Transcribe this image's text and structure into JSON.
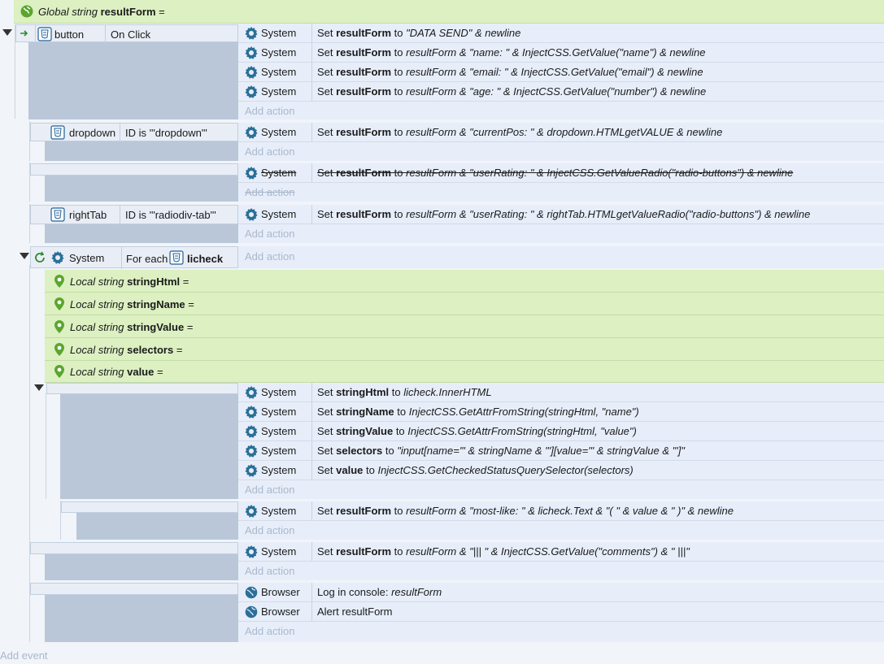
{
  "global": {
    "kind": "Global string",
    "name": "resultForm",
    "eq": "="
  },
  "obj": {
    "system": "System",
    "browser": "Browser"
  },
  "add_action": "Add action",
  "add_event": "Add event",
  "ev1": {
    "object": "button",
    "trigger": "On Click",
    "a1": {
      "pre": "Set ",
      "var": "resultForm",
      "mid": " to ",
      "expr": "\"DATA SEND\" & newline"
    },
    "a2": {
      "pre": "Set ",
      "var": "resultForm",
      "mid": " to ",
      "expr": "resultForm & \"name: \" & InjectCSS.GetValue(\"name\") & newline"
    },
    "a3": {
      "pre": "Set ",
      "var": "resultForm",
      "mid": " to ",
      "expr": "resultForm & \"email: \" & InjectCSS.GetValue(\"email\") & newline"
    },
    "a4": {
      "pre": "Set ",
      "var": "resultForm",
      "mid": " to ",
      "expr": "resultForm & \"age: \" & InjectCSS.GetValue(\"number\") & newline"
    }
  },
  "ev2": {
    "object": "dropdown",
    "cond": "ID is '\"dropdown\"'",
    "a1": {
      "pre": "Set ",
      "var": "resultForm",
      "mid": " to ",
      "expr": "resultForm & \"currentPos: \" & dropdown.HTMLgetVALUE & newline"
    }
  },
  "ev3": {
    "a1": {
      "pre": "Set ",
      "var": "resultForm",
      "mid": " to ",
      "expr": "resultForm & \"userRating: \" & InjectCSS.GetValueRadio(\"radio-buttons\") & newline"
    }
  },
  "ev4": {
    "object": "rightTab",
    "cond": "ID is '\"radiodiv-tab\"'",
    "a1": {
      "pre": "Set ",
      "var": "resultForm",
      "mid": " to ",
      "expr": "resultForm & \"userRating: \" & rightTab.HTMLgetValueRadio(\"radio-buttons\") & newline"
    }
  },
  "ev5": {
    "object": "System",
    "trigger": "For each",
    "iter": "licheck",
    "locals": [
      {
        "kind": "Local string",
        "name": "stringHtml",
        "eq": "="
      },
      {
        "kind": "Local string",
        "name": "stringName",
        "eq": "="
      },
      {
        "kind": "Local string",
        "name": "stringValue",
        "eq": "="
      },
      {
        "kind": "Local string",
        "name": "selectors",
        "eq": "="
      },
      {
        "kind": "Local string",
        "name": "value",
        "eq": "="
      }
    ],
    "s1": [
      {
        "pre": "Set ",
        "var": "stringHtml",
        "mid": " to ",
        "expr": "licheck.InnerHTML"
      },
      {
        "pre": "Set ",
        "var": "stringName",
        "mid": " to ",
        "expr": "InjectCSS.GetAttrFromString(stringHtml, \"name\")"
      },
      {
        "pre": "Set ",
        "var": "stringValue",
        "mid": " to ",
        "expr": "InjectCSS.GetAttrFromString(stringHtml, \"value\")"
      },
      {
        "pre": "Set ",
        "var": "selectors",
        "mid": " to ",
        "expr": "\"input[name='\" & stringName & \"'][value='\" & stringValue & \"']\""
      },
      {
        "pre": "Set ",
        "var": "value",
        "mid": " to ",
        "expr": "InjectCSS.GetCheckedStatusQuerySelector(selectors)"
      }
    ],
    "s2": {
      "pre": "Set ",
      "var": "resultForm",
      "mid": " to ",
      "expr": "resultForm & \"most-like: \" & licheck.Text & \"( \" & value & \" )\" & newline"
    },
    "s3": {
      "pre": "Set ",
      "var": "resultForm",
      "mid": " to ",
      "expr": "resultForm & \"||| \" & InjectCSS.GetValue(\"comments\") & \" |||\""
    },
    "s4": {
      "log": "Log in console: ",
      "logval": "resultForm",
      "alert": "Alert resultForm"
    }
  }
}
